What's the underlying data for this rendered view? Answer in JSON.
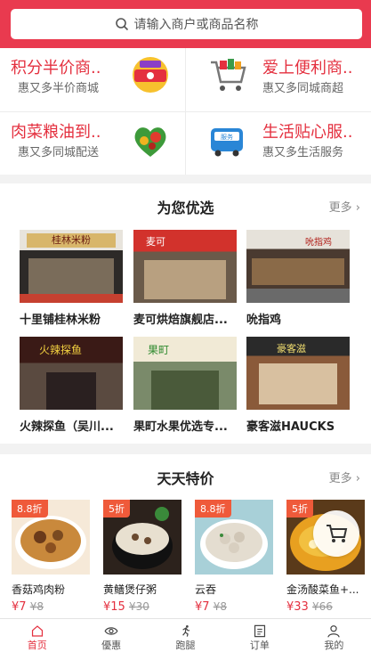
{
  "search": {
    "placeholder": "请输入商户或商品名称"
  },
  "promo": [
    {
      "title": "积分半价商..",
      "subtitle": "惠又多半价商城",
      "icon": "points-gift-icon"
    },
    {
      "title": "爱上便利商..",
      "subtitle": "惠又多同城商超",
      "icon": "shopping-cart-icon"
    },
    {
      "title": "肉菜粮油到..",
      "subtitle": "惠又多同城配送",
      "icon": "vegetable-heart-icon"
    },
    {
      "title": "生活贴心服..",
      "subtitle": "惠又多生活服务",
      "icon": "service-bus-icon"
    }
  ],
  "featured": {
    "title": "为您优选",
    "more": "更多",
    "shops": [
      {
        "name": "十里铺桂林米粉",
        "sign": "桂林米粉"
      },
      {
        "name": "麦可烘焙旗舰店...",
        "sign": "麦可"
      },
      {
        "name": "吮指鸡",
        "sign": "吮指鸡"
      },
      {
        "name": "火辣探鱼（吴川...",
        "sign": "火辣探鱼"
      },
      {
        "name": "果町水果优选专...",
        "sign": "果町"
      },
      {
        "name": "豪客滋HAUCKS",
        "sign": "豪客滋"
      }
    ]
  },
  "deals": {
    "title": "天天特价",
    "more": "更多",
    "items": [
      {
        "name": "香菇鸡肉粉",
        "badge": "8.8折",
        "price": "¥7",
        "old": "¥8"
      },
      {
        "name": "黄鳝煲仔粥",
        "badge": "5折",
        "price": "¥15",
        "old": "¥30"
      },
      {
        "name": "云吞",
        "badge": "8.8折",
        "price": "¥7",
        "old": "¥8"
      },
      {
        "name": "金汤酸菜鱼+...",
        "badge": "5折",
        "price": "¥33",
        "old": "¥66"
      }
    ]
  },
  "tabs": [
    {
      "label": "首页",
      "icon": "home-icon",
      "active": true
    },
    {
      "label": "優惠",
      "icon": "eye-icon",
      "active": false
    },
    {
      "label": "跑腿",
      "icon": "runner-icon",
      "active": false
    },
    {
      "label": "订单",
      "icon": "order-list-icon",
      "active": false
    },
    {
      "label": "我的",
      "icon": "user-icon",
      "active": false
    }
  ],
  "colors": {
    "brand": "#e93a4f",
    "price": "#e4303f",
    "badge": "#ef5a3a"
  }
}
